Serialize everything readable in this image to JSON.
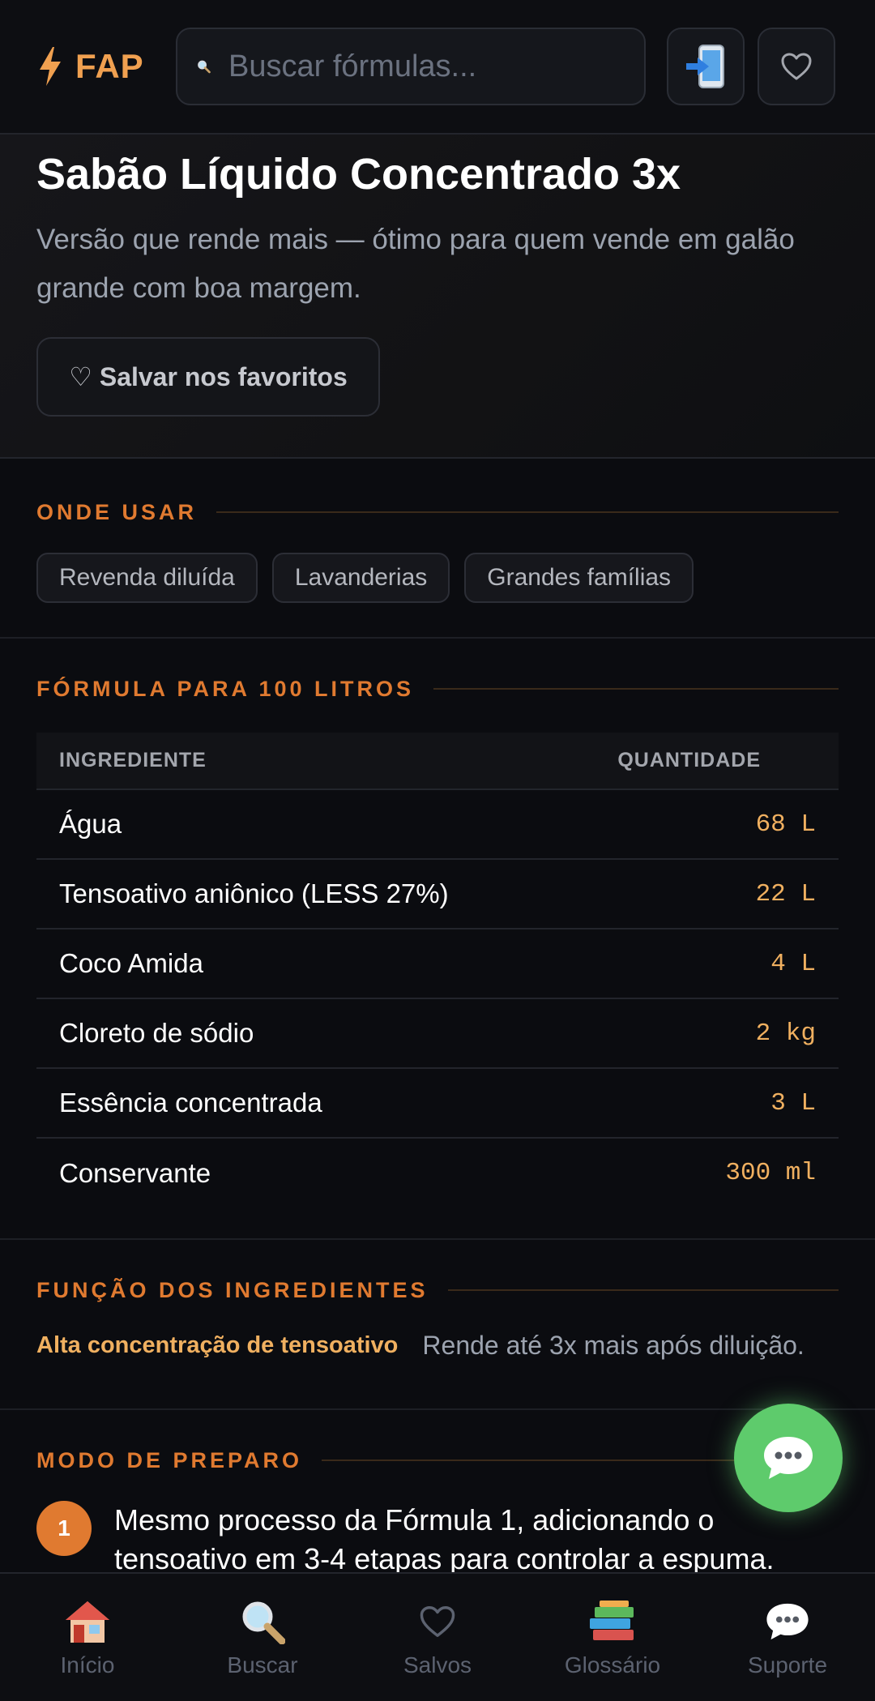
{
  "header": {
    "brand": "FAP",
    "search_placeholder": "Buscar fórmulas..."
  },
  "hero": {
    "title": "Sabão Líquido Concentrado 3x",
    "description": "Versão que rende mais — ótimo para quem vende em galão grande com boa margem.",
    "favorite_button": "♡ Salvar nos favoritos"
  },
  "usage": {
    "title": "ONDE USAR",
    "tags": [
      "Revenda diluída",
      "Lavanderias",
      "Grandes famílias"
    ]
  },
  "formula": {
    "title": "FÓRMULA PARA 100 LITROS",
    "columns": [
      "INGREDIENTE",
      "QUANTIDADE"
    ],
    "rows": [
      {
        "ingredient": "Água",
        "quantity": "68 L"
      },
      {
        "ingredient": "Tensoativo aniônico (LESS 27%)",
        "quantity": "22 L"
      },
      {
        "ingredient": "Coco Amida",
        "quantity": "4 L"
      },
      {
        "ingredient": "Cloreto de sódio",
        "quantity": "2 kg"
      },
      {
        "ingredient": "Essência concentrada",
        "quantity": "3 L"
      },
      {
        "ingredient": "Conservante",
        "quantity": "300 ml"
      }
    ]
  },
  "functions": {
    "title": "FUNÇÃO DOS INGREDIENTES",
    "items": [
      {
        "name": "Alta concentração de tensoativo",
        "description": "Rende até 3x mais após diluição."
      }
    ]
  },
  "preparation": {
    "title": "MODO DE PREPARO",
    "steps": [
      {
        "number": "1",
        "text": "Mesmo processo da Fórmula 1, adicionando o tensoativo em 3-4 etapas para controlar a espuma."
      }
    ]
  },
  "nav": {
    "items": [
      {
        "label": "Início",
        "icon": "house-icon"
      },
      {
        "label": "Buscar",
        "icon": "magnifier-icon"
      },
      {
        "label": "Salvos",
        "icon": "heart-icon"
      },
      {
        "label": "Glossário",
        "icon": "books-icon"
      },
      {
        "label": "Suporte",
        "icon": "chat-bubble-icon"
      }
    ]
  },
  "colors": {
    "accent": "#e07a30",
    "quantity": "#f0b060",
    "fab": "#5ecb6c",
    "background": "#0b0c10"
  }
}
